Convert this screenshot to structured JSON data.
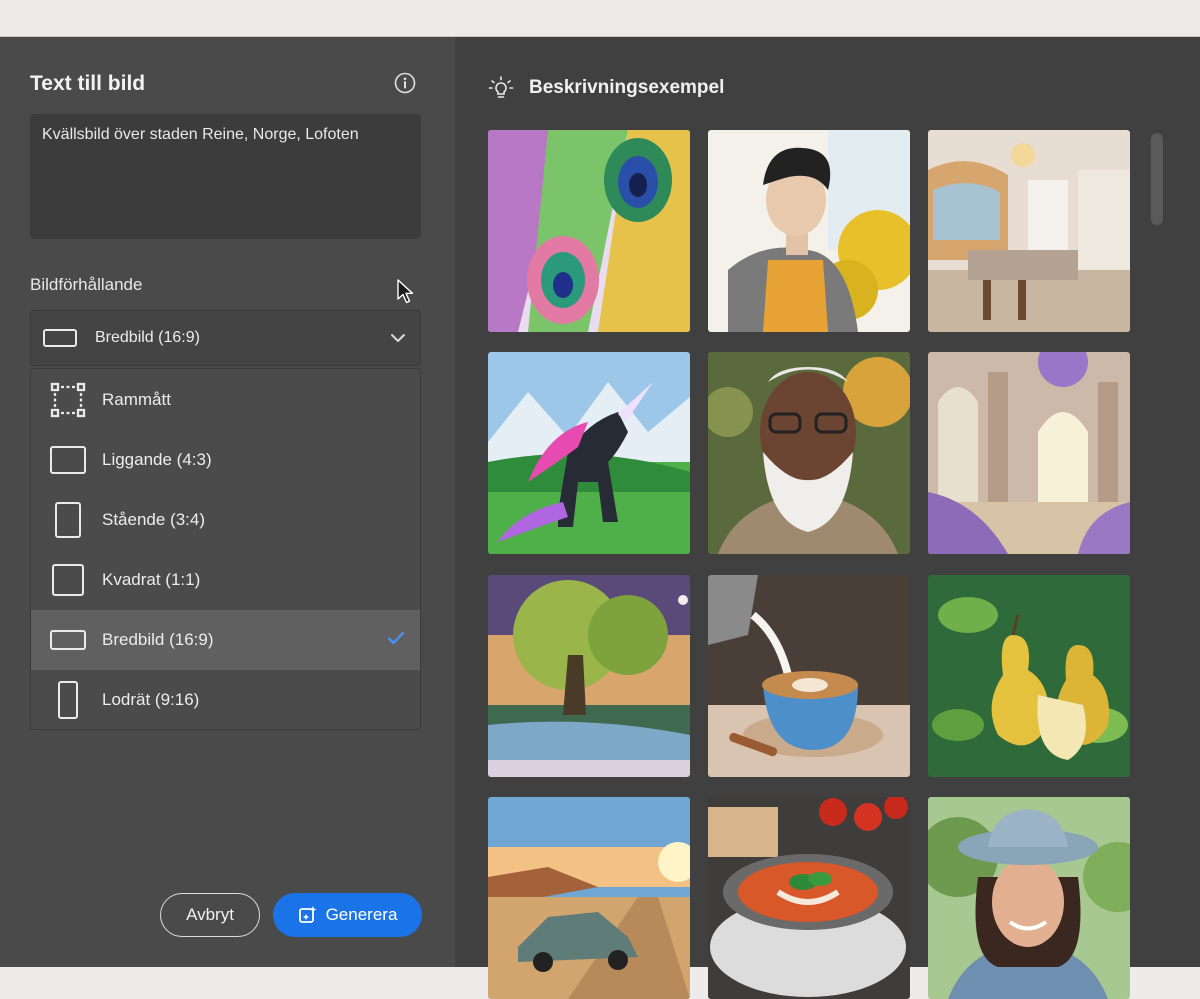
{
  "left_panel": {
    "title": "Text till bild",
    "info_icon": "info-icon",
    "prompt_text": "Kvällsbild över staden Reine, Norge, Lofoten",
    "aspect_section_label": "Bildförhållande",
    "selected_value": "Bredbild (16:9)",
    "options": [
      {
        "label": "Rammått",
        "icon": "crop-frame-icon",
        "selected": false
      },
      {
        "label": "Liggande (4:3)",
        "icon": "landscape-icon",
        "selected": false
      },
      {
        "label": "Stående (3:4)",
        "icon": "portrait-icon",
        "selected": false
      },
      {
        "label": "Kvadrat (1:1)",
        "icon": "square-icon",
        "selected": false
      },
      {
        "label": "Bredbild (16:9)",
        "icon": "widescreen-icon",
        "selected": true
      },
      {
        "label": "Lodrät (9:16)",
        "icon": "vertical-icon",
        "selected": false
      }
    ],
    "cancel_label": "Avbryt",
    "generate_label": "Generera"
  },
  "examples_panel": {
    "title": "Beskrivningsexempel",
    "header_icon": "lightbulb-icon",
    "thumbnails": [
      "peacock-feathers-illustration",
      "sketched-man-with-mimosa",
      "bright-kitchen-interior",
      "unicorn-in-mountain-meadow",
      "bearded-elderly-man-portrait",
      "lavender-palace-hall",
      "willow-tree-by-river",
      "latte-art-coffee-cup",
      "pears-on-leaves",
      "vintage-car-desert-road",
      "tomato-soup-with-basil",
      "woman-in-sun-hat"
    ]
  },
  "colors": {
    "panel_left": "#4a4a4a",
    "panel_right": "#404040",
    "accent_blue": "#1a74e8",
    "selected_row": "#606060"
  }
}
